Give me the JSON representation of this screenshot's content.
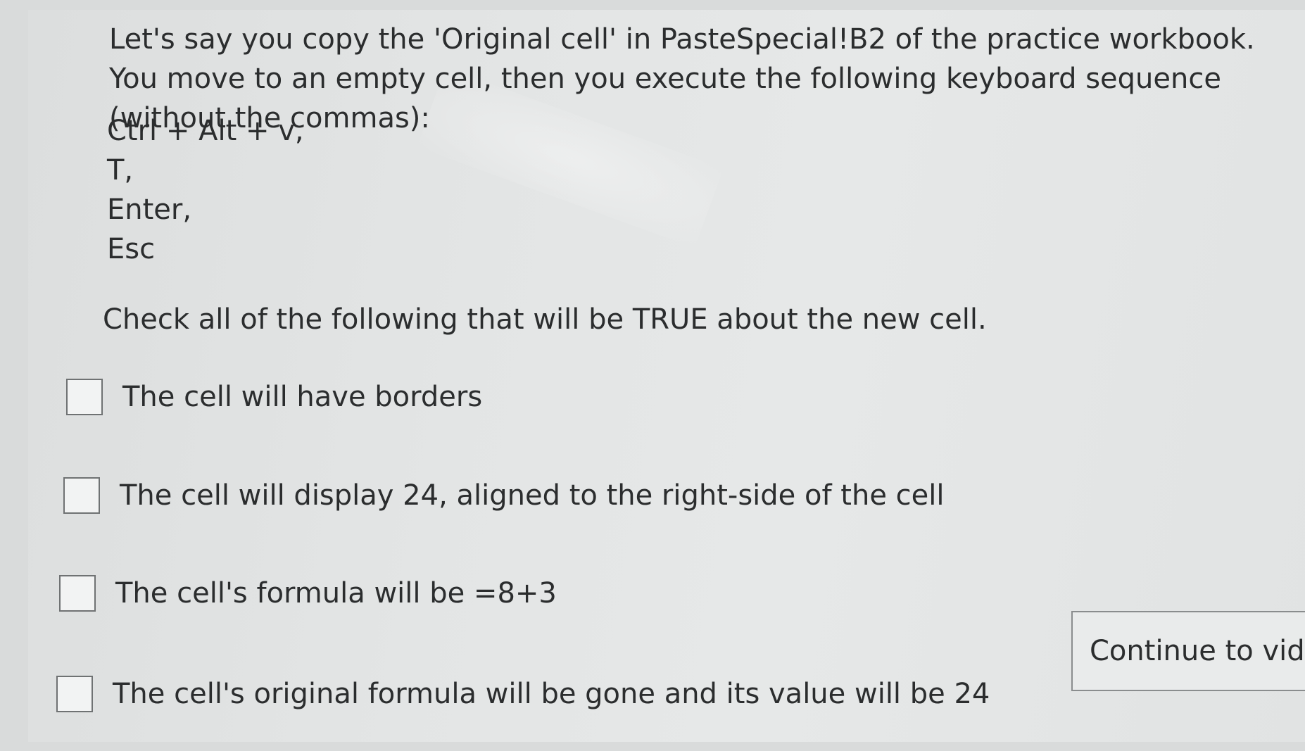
{
  "question": {
    "text": "Let's say you copy the 'Original cell' in PasteSpecial!B2 of the practice workbook. You move to an empty cell, then you execute the following keyboard sequence (without the commas):",
    "key_sequence": [
      "Ctrl + Alt + v,",
      "T,",
      "Enter,",
      "Esc"
    ]
  },
  "instruction": "Check all of the following that will be TRUE about the new cell.",
  "options": [
    {
      "label": "The cell will have borders",
      "checked": false
    },
    {
      "label": "The cell will display 24, aligned to the right-side of the cell",
      "checked": false
    },
    {
      "label": "The cell's formula will be =8+3",
      "checked": false
    },
    {
      "label": "The cell's original formula will be gone and its value will be 24",
      "checked": false
    }
  ],
  "continue_button": {
    "label": "Continue to vide"
  }
}
